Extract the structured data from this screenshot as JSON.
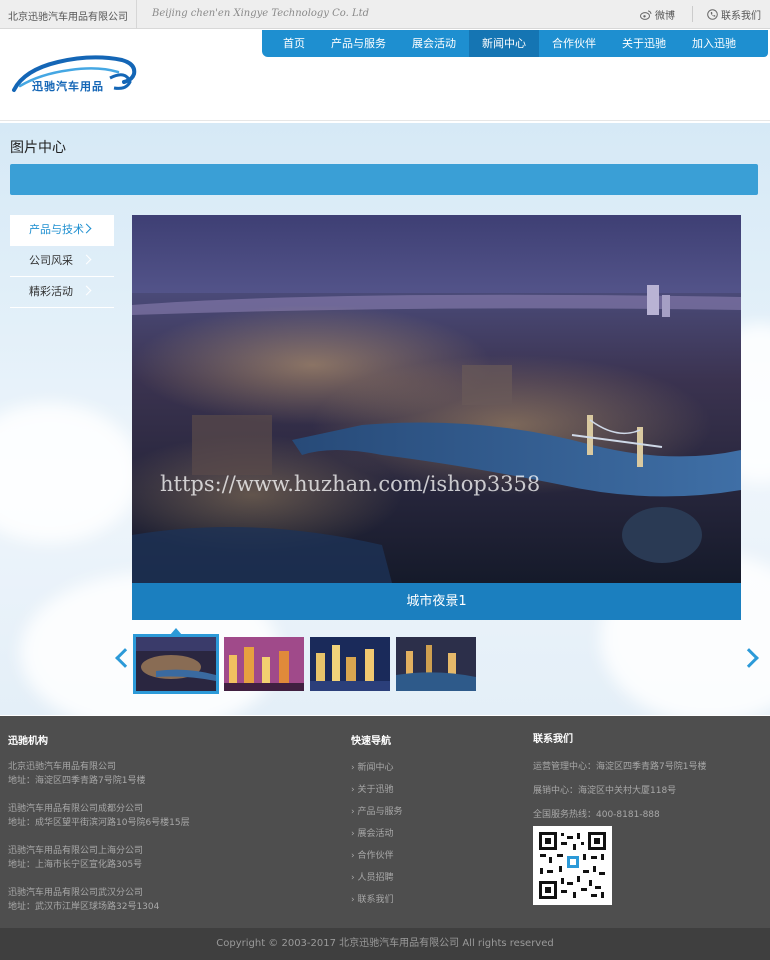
{
  "topbar": {
    "company": "北京迅驰汽车用品有限公司",
    "english": "Beijing chen'en Xingye Technology Co. Ltd",
    "weibo": "微博",
    "contact": "联系我们"
  },
  "nav": [
    "首页",
    "产品与服务",
    "展会活动",
    "新闻中心",
    "合作伙伴",
    "关于迅驰",
    "加入迅驰"
  ],
  "logo_text": "迅驰汽车用品",
  "page_title": "图片中心",
  "sidebar": [
    {
      "label": "产品与技术",
      "active": true
    },
    {
      "label": "公司风采",
      "active": false
    },
    {
      "label": "精彩活动",
      "active": false
    }
  ],
  "watermark": "https://www.huzhan.com/ishop3358",
  "caption": "城市夜景1",
  "footer": {
    "col1_title": "迅驰机构",
    "offices": [
      {
        "name": "北京迅驰汽车用品有限公司",
        "addr": "地址：海淀区四季青路7号院1号楼"
      },
      {
        "name": "迅驰汽车用品有限公司成都分公司",
        "addr": "地址：成华区望平街滨河路10号院6号楼15层"
      },
      {
        "name": "迅驰汽车用品有限公司上海分公司",
        "addr": "地址：上海市长宁区宣化路305号"
      },
      {
        "name": "迅驰汽车用品有限公司武汉分公司",
        "addr": "地址：武汉市江岸区球场路32号1304"
      }
    ],
    "col2_title": "快速导航",
    "quick_links": [
      "新闻中心",
      "关于迅驰",
      "产品与服务",
      "展会活动",
      "合作伙伴",
      "人员招聘",
      "联系我们"
    ],
    "col3_title": "联系我们",
    "contacts": [
      "运营管理中心：海淀区四季青路7号院1号楼",
      "展销中心：海淀区中关村大厦118号",
      "全国服务热线：400-8181-888"
    ]
  },
  "copyright": "Copyright © 2003-2017 北京迅驰汽车用品有限公司 All rights reserved"
}
